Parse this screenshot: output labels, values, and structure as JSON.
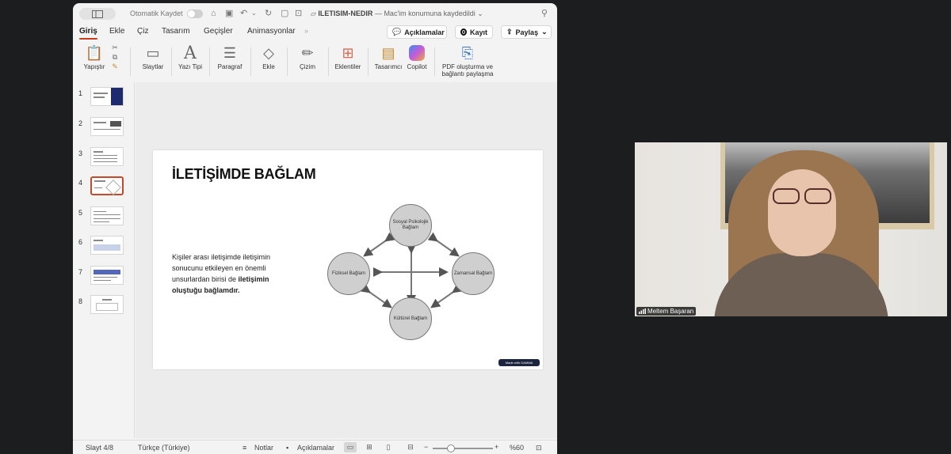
{
  "titlebar": {
    "autosave_label": "Otomatik Kaydet",
    "doc_name": "ILETISIM-NEDIR",
    "doc_status": "— Mac'im konumuna kaydedildi"
  },
  "tabs": [
    {
      "label": "Giriş",
      "active": true
    },
    {
      "label": "Ekle"
    },
    {
      "label": "Çiz"
    },
    {
      "label": "Tasarım"
    },
    {
      "label": "Geçişler"
    },
    {
      "label": "Animasyonlar"
    }
  ],
  "actions": {
    "comments_label": "Açıklamalar",
    "record_label": "Kayıt",
    "share_label": "Paylaş"
  },
  "ribbon": {
    "paste": "Yapıştır",
    "slides": "Slaytlar",
    "font": "Yazı Tipi",
    "paragraph": "Paragraf",
    "insert": "Ekle",
    "drawing": "Çizim",
    "addins": "Eklentiler",
    "designer": "Tasarımcı",
    "copilot": "Copilot",
    "pdf_line1": "PDF oluşturma ve",
    "pdf_line2": "bağlantı paylaşma"
  },
  "thumbnails": [
    "1",
    "2",
    "3",
    "4",
    "5",
    "6",
    "7",
    "8"
  ],
  "selected_slide": 4,
  "slide": {
    "title": "İLETİŞİMDE BAĞLAM",
    "body_prefix": "Kişiler arası iletişimde iletişimin sonucunu etkileyen en önemli unsurlardan birisi de ",
    "body_bold": "iletişimin oluştuğu bağlamdır.",
    "diagram": {
      "top": "Sosyal Psikolojik Bağlam",
      "left": "Fiziksel Bağlam",
      "right": "Zamansal Bağlam",
      "bottom": "Kültürel Bağlam"
    },
    "badge": "Made with GAMMA"
  },
  "statusbar": {
    "slide_indicator": "Slayt 4/8",
    "language": "Türkçe (Türkiye)",
    "notes_label": "Notlar",
    "comments_label": "Açıklamalar",
    "zoom": "%60"
  },
  "webcam": {
    "participant_name": "Meltem Başaran"
  },
  "colors": {
    "accent_tab": "#c43e1c",
    "selected_thumb": "#c44a2c",
    "background": "#1b1d1f"
  }
}
